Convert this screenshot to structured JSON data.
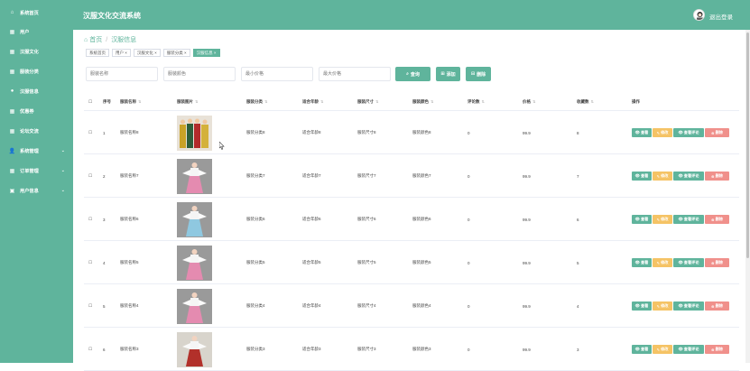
{
  "app": {
    "title": "汉服文化交流系统",
    "logout": "退出登录"
  },
  "sidebar": {
    "items": [
      {
        "label": "系统首页",
        "icon": "home-icon"
      },
      {
        "label": "用户",
        "icon": "grid-icon"
      },
      {
        "label": "汉服文化",
        "icon": "grid-icon"
      },
      {
        "label": "服装分类",
        "icon": "grid-icon"
      },
      {
        "label": "汉服信息",
        "icon": "bulb-icon"
      },
      {
        "label": "优惠券",
        "icon": "grid-icon"
      },
      {
        "label": "论坛交流",
        "icon": "grid-icon"
      },
      {
        "label": "系统管理",
        "icon": "user-icon"
      },
      {
        "label": "订单管理",
        "icon": "grid-icon"
      },
      {
        "label": "用户信息",
        "icon": "card-icon"
      }
    ]
  },
  "breadcrumb": {
    "home": "首页",
    "current": "汉服信息"
  },
  "tags": [
    {
      "label": "系统首页",
      "active": false
    },
    {
      "label": "用户 ×",
      "active": false
    },
    {
      "label": "汉服文化 ×",
      "active": false
    },
    {
      "label": "服装分类 ×",
      "active": false
    },
    {
      "label": "汉服信息 ×",
      "active": true
    }
  ],
  "search": {
    "name_placeholder": "服装名称",
    "color_placeholder": "服装颜色",
    "min_price_placeholder": "最小价格",
    "max_price_placeholder": "最大价格",
    "query_label": "查询",
    "add_label": "添加",
    "delete_label": "删除"
  },
  "table": {
    "headers": [
      "序号",
      "服装名称",
      "服装图片",
      "服装分类",
      "适合年龄",
      "服装尺寸",
      "服装颜色",
      "评论数",
      "价格",
      "收藏数",
      "操作"
    ],
    "rows": [
      {
        "no": "1",
        "name": "服装名称8",
        "category": "服装分类8",
        "age": "适合年龄8",
        "size": "服装尺寸8",
        "color": "服装颜色8",
        "comments": "0",
        "price": "99.9",
        "favs": "8"
      },
      {
        "no": "2",
        "name": "服装名称7",
        "category": "服装分类7",
        "age": "适合年龄7",
        "size": "服装尺寸7",
        "color": "服装颜色7",
        "comments": "0",
        "price": "99.9",
        "favs": "7"
      },
      {
        "no": "3",
        "name": "服装名称6",
        "category": "服装分类6",
        "age": "适合年龄6",
        "size": "服装尺寸6",
        "color": "服装颜色6",
        "comments": "0",
        "price": "99.9",
        "favs": "6"
      },
      {
        "no": "4",
        "name": "服装名称5",
        "category": "服装分类5",
        "age": "适合年龄5",
        "size": "服装尺寸5",
        "color": "服装颜色5",
        "comments": "0",
        "price": "99.9",
        "favs": "5"
      },
      {
        "no": "5",
        "name": "服装名称4",
        "category": "服装分类4",
        "age": "适合年龄4",
        "size": "服装尺寸4",
        "color": "服装颜色4",
        "comments": "0",
        "price": "99.9",
        "favs": "4"
      },
      {
        "no": "6",
        "name": "服装名称3",
        "category": "服装分类3",
        "age": "适合年龄3",
        "size": "服装尺寸3",
        "color": "服装颜色3",
        "comments": "0",
        "price": "99.9",
        "favs": "3"
      }
    ],
    "ops": {
      "view": "查看",
      "edit": "修改",
      "comments": "查看评论",
      "delete": "删除"
    }
  },
  "colors": {
    "primary": "#5fb49c",
    "warning": "#f5c365",
    "danger": "#f0908b"
  }
}
